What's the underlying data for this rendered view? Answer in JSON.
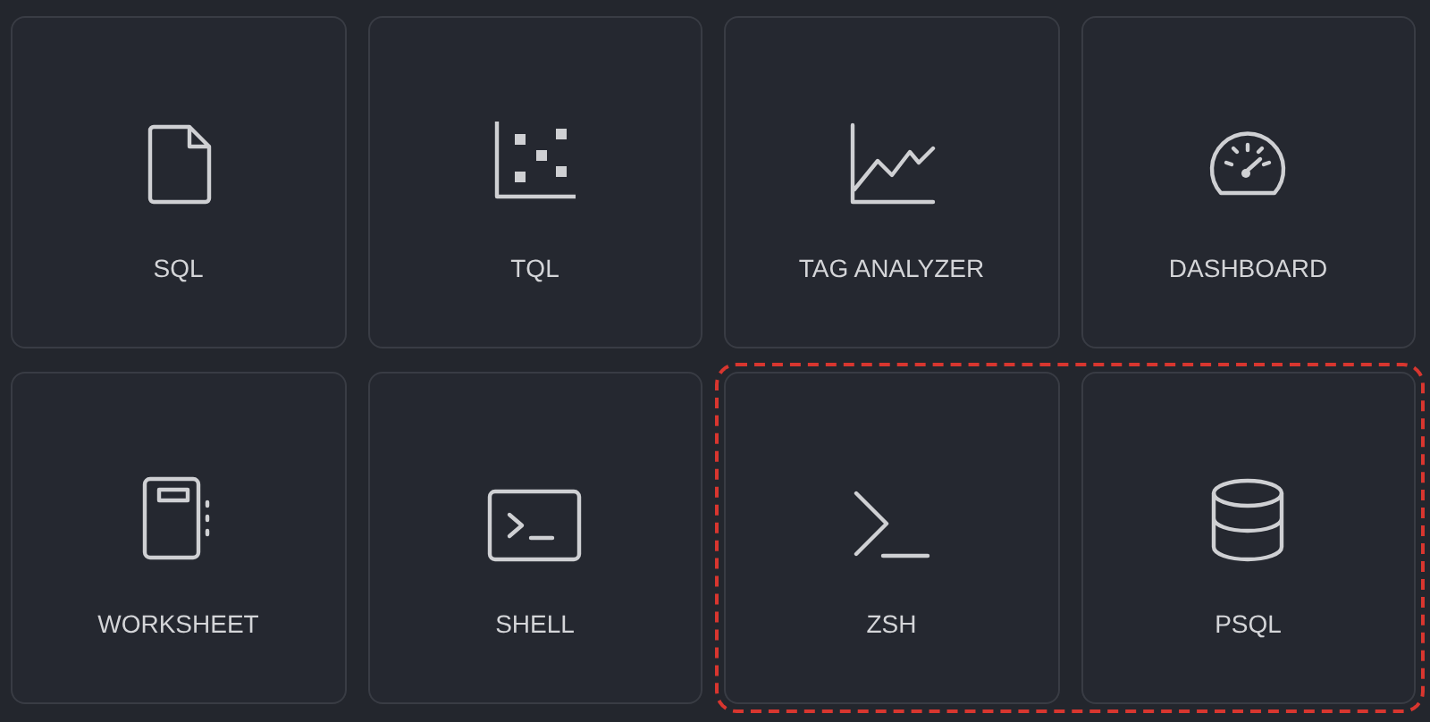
{
  "tiles": [
    {
      "label": "SQL",
      "kind": "file"
    },
    {
      "label": "TQL",
      "kind": "scatter"
    },
    {
      "label": "TAG ANALYZER",
      "kind": "line-chart"
    },
    {
      "label": "DASHBOARD",
      "kind": "gauge"
    },
    {
      "label": "WORKSHEET",
      "kind": "notebook"
    },
    {
      "label": "SHELL",
      "kind": "shell"
    },
    {
      "kind": "highlight-group",
      "tiles": [
        {
          "label": "ZSH",
          "kind": "terminal"
        },
        {
          "label": "PSQL",
          "kind": "database"
        }
      ]
    }
  ]
}
